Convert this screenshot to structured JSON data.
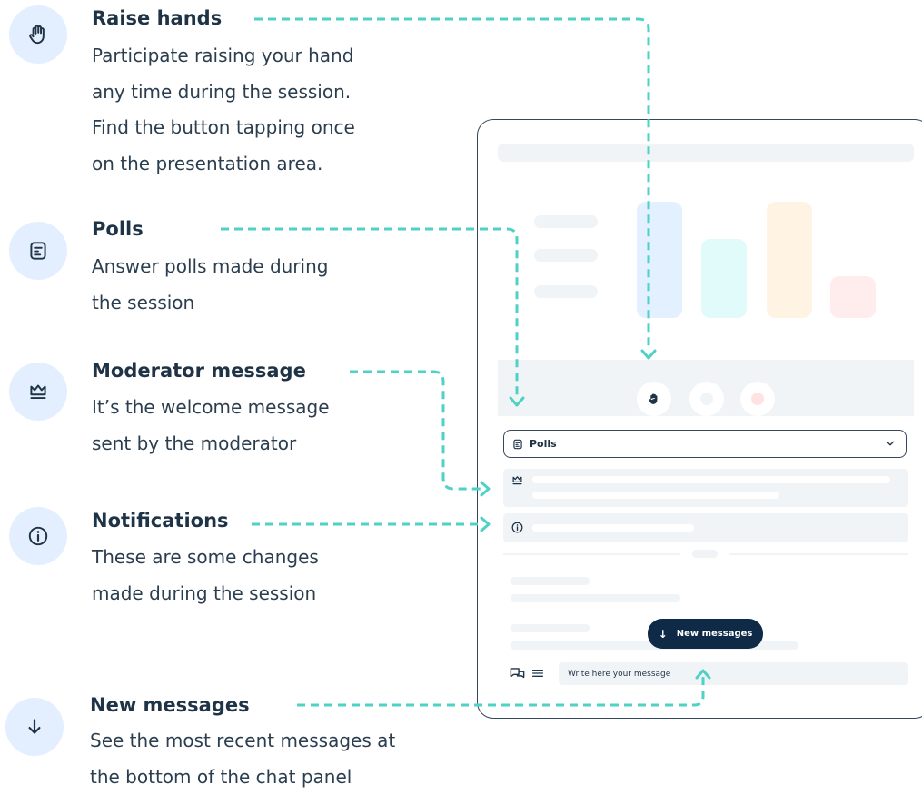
{
  "features": [
    {
      "id": "raise-hands",
      "icon": "raised-hand-icon",
      "title": "Raise hands",
      "lines": [
        "Participate raising your hand",
        "any time during the session.",
        "Find the button tapping once",
        "on the presentation area."
      ]
    },
    {
      "id": "polls",
      "icon": "poll-icon",
      "title": "Polls",
      "lines": [
        "Answer polls made during",
        "the session"
      ]
    },
    {
      "id": "moderator-message",
      "icon": "crown-icon",
      "title": "Moderator message",
      "lines": [
        "It’s the welcome message",
        "sent by the moderator"
      ]
    },
    {
      "id": "notifications",
      "icon": "info-icon",
      "title": "Notifications",
      "lines": [
        "These are some changes",
        "made during the session"
      ]
    },
    {
      "id": "new-messages",
      "icon": "arrow-down-icon",
      "title": "New messages",
      "lines": [
        "See the most recent messages at",
        "the bottom of the chat panel"
      ]
    }
  ],
  "phone": {
    "dropdown_label": "Polls",
    "new_messages_label": "New messages",
    "input_placeholder": "Write here your message"
  },
  "colors": {
    "text": "#1f3347",
    "icon_bg": "#e3efff",
    "connector": "#4fd1c5",
    "pill": "#0e2a47",
    "bar_blue": "#e2f0ff",
    "bar_cyan": "#e0fbfa",
    "bar_orange": "#fff4e3",
    "bar_red": "#ffeded"
  }
}
